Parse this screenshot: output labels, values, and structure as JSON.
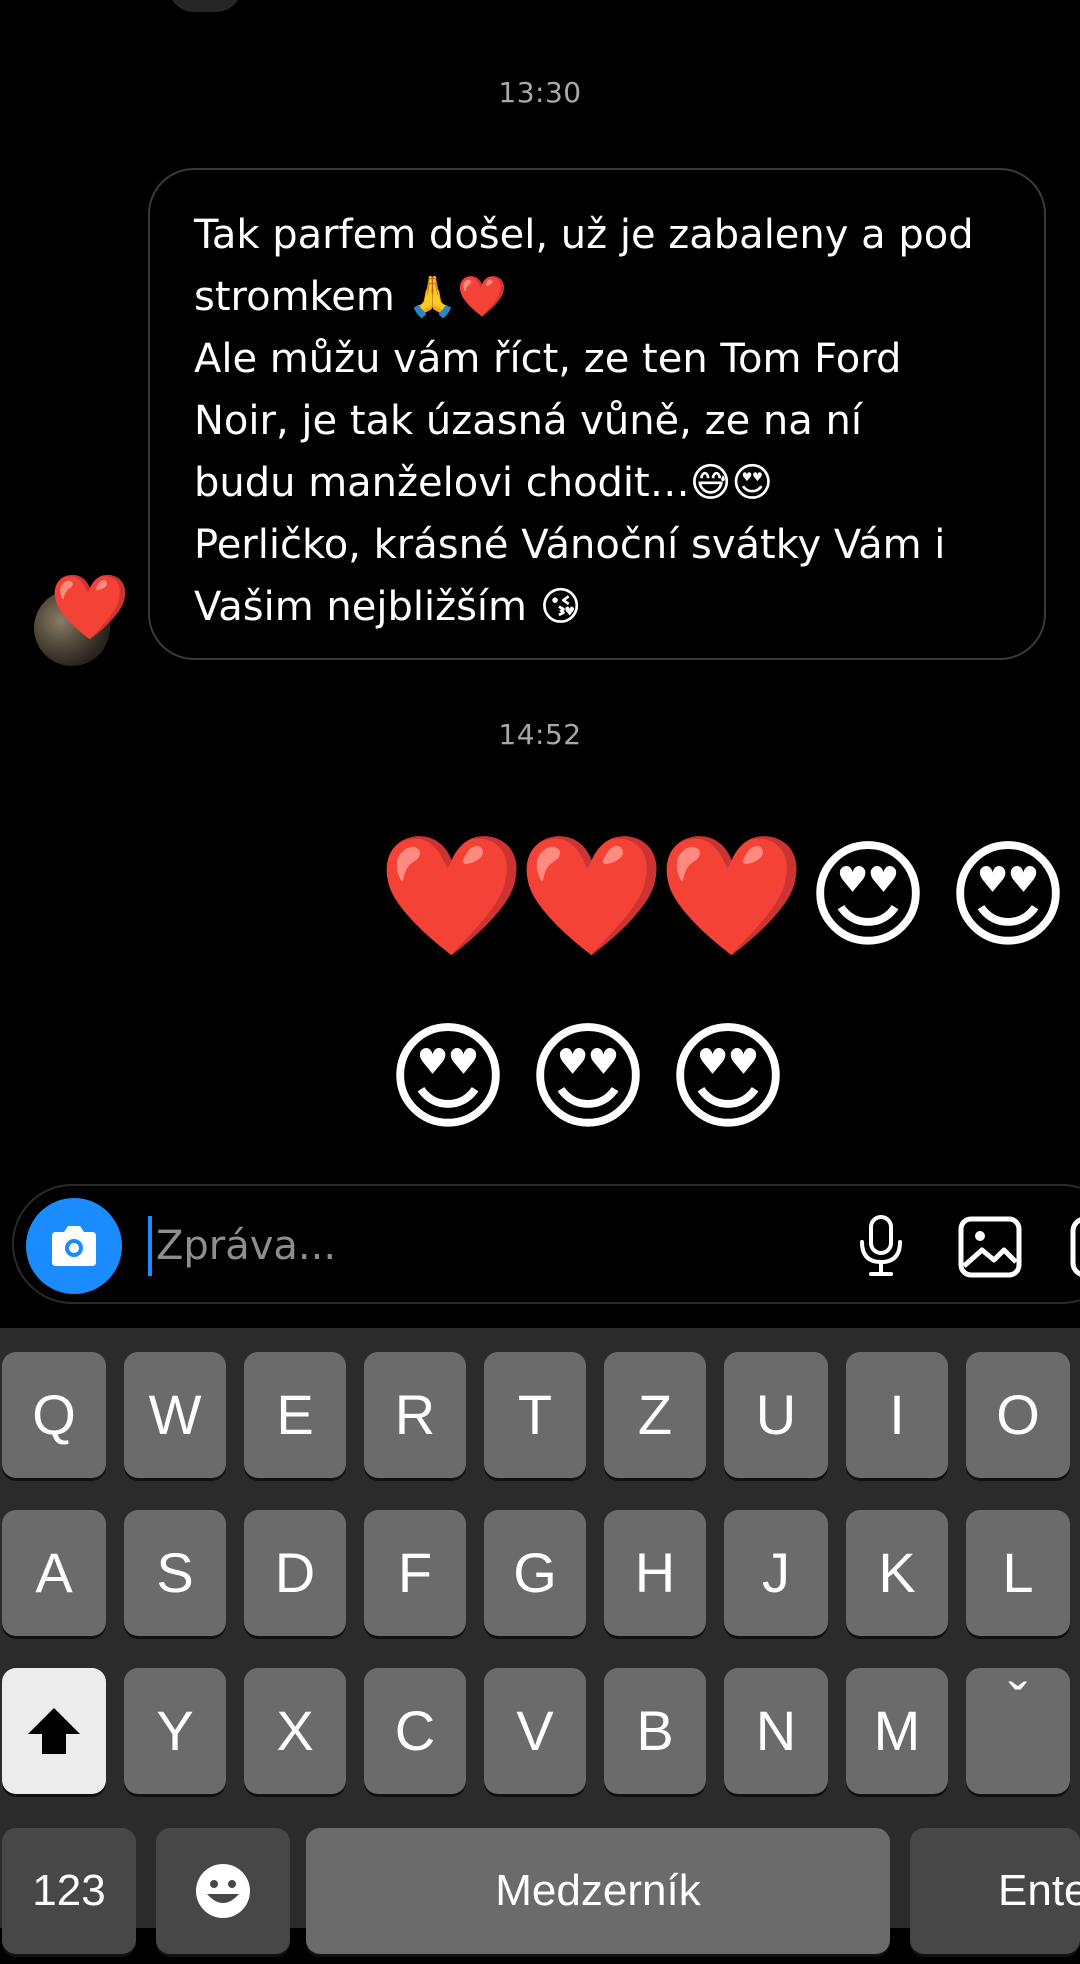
{
  "chat": {
    "timestamp_1": "13:30",
    "message_lines": [
      "Tak parfem došel, už je zabaleny a pod",
      "stromkem 🙏❤️",
      "Ale můžu vám říct, ze ten Tom Ford",
      "Noir, je tak úzasná vůně,  ze na ní",
      "budu manželovi chodit…😅😍",
      "Perličko, krásné Vánoční svátky Vám i",
      "Vašim nejbližším 😘"
    ],
    "reaction": "❤️",
    "timestamp_2": "14:52",
    "sent_row_1": [
      "❤️",
      "❤️",
      "❤️",
      "😍",
      "😍"
    ],
    "sent_row_2": [
      "😍",
      "😍",
      "😍"
    ]
  },
  "composer": {
    "placeholder": "Zpráva..."
  },
  "keyboard": {
    "row1": [
      "Q",
      "W",
      "E",
      "R",
      "T",
      "Z",
      "U",
      "I",
      "O"
    ],
    "row2": [
      "A",
      "S",
      "D",
      "F",
      "G",
      "H",
      "J",
      "K",
      "L"
    ],
    "row3": [
      "Y",
      "X",
      "C",
      "V",
      "B",
      "N",
      "M"
    ],
    "accent_key": "ˇ",
    "numbers_key": "123",
    "space_key": "Medzerník",
    "enter_key": "Enter"
  }
}
